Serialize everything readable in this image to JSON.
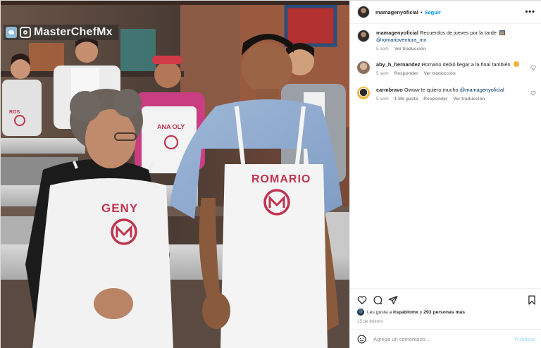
{
  "media": {
    "watermark": "MasterChefMx",
    "aprons": {
      "left_small": "ROS",
      "center_back": "ANA OLY",
      "front_woman": "GENY",
      "front_man": "ROMARIO"
    },
    "icons": [
      "twitter-icon",
      "instagram-icon"
    ]
  },
  "header": {
    "username": "mamagenyoficial",
    "separator": "•",
    "follow_label": "Seguir",
    "more_label": "•••"
  },
  "comments": [
    {
      "username": "mamagenyoficial",
      "text": "Recuerdos de jueves por la tarde",
      "emoji": "framed-picture",
      "mention": "@romarioventura_mx",
      "time": "5 sem",
      "actions": [
        "Ver traducción"
      ]
    },
    {
      "username": "aby_h_hernandez",
      "text": "Romario debió llegar a la final también",
      "emoji": "face",
      "time": "5 sem",
      "actions": [
        "Responder",
        "Ver traducción"
      ]
    },
    {
      "username": "carmbravo",
      "text": "Owww te quiero mucho",
      "mention": "@mamagenyoficial",
      "time": "5 sem",
      "likes": "1 Me gusta",
      "actions": [
        "Responder",
        "Ver traducción"
      ]
    }
  ],
  "likes": {
    "prefix": "Les gusta a",
    "user": "itspablomx",
    "middle": "y",
    "others": "293 personas más"
  },
  "date": "15 de febrero",
  "add_comment": {
    "placeholder": "Agrega un comentario...",
    "publish_label": "Publicar"
  },
  "colors": {
    "link_blue": "#0095f6",
    "mention_blue": "#00376b",
    "publish_disabled": "#b2dffc",
    "apron_text": "#c0344f",
    "secondary_text": "#8e8e8e"
  }
}
